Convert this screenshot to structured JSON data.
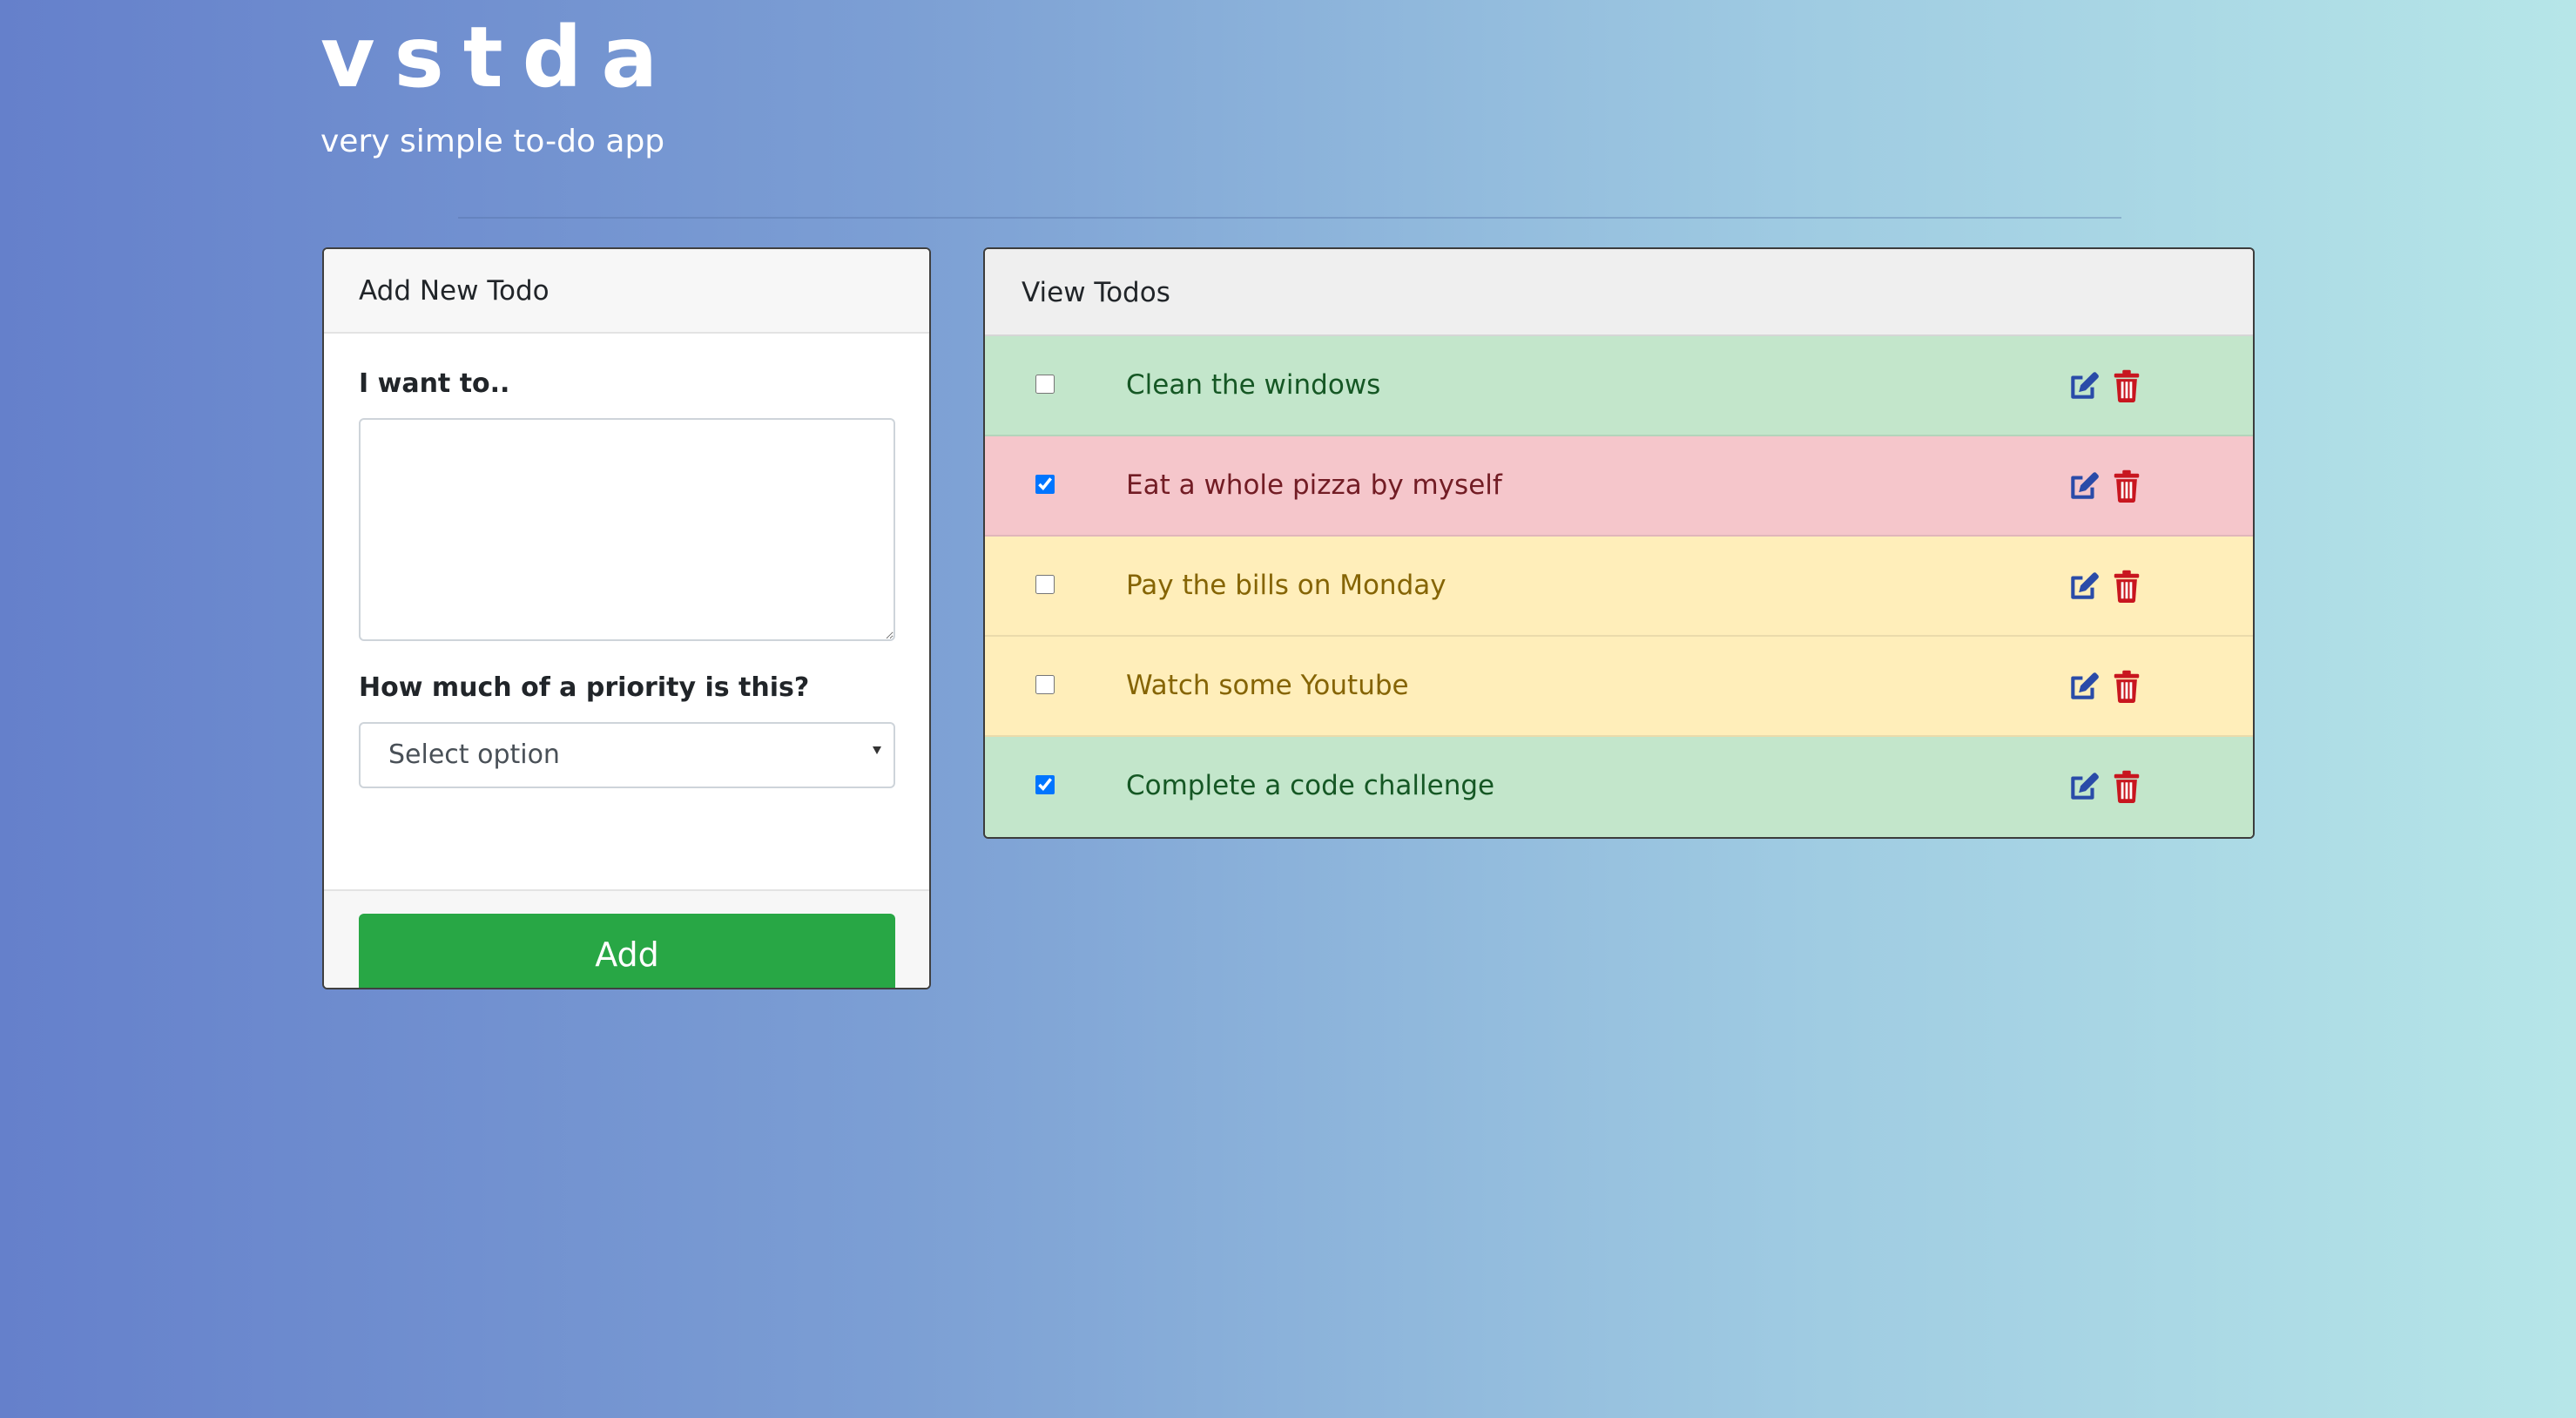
{
  "header": {
    "title": "vstda",
    "subtitle": "very simple to-do app"
  },
  "add_card": {
    "title": "Add New Todo",
    "todo_label": "I want to..",
    "todo_value": "",
    "priority_label": "How much of a priority is this?",
    "priority_selected": "Select option",
    "add_button": "Add"
  },
  "view_card": {
    "title": "View Todos",
    "todos": [
      {
        "text": "Clean the windows",
        "checked": false,
        "priority": "low",
        "bg": "#c3e6cb",
        "fg": "#155724"
      },
      {
        "text": "Eat a whole pizza by myself",
        "checked": true,
        "priority": "high",
        "bg": "#f5c6cb",
        "fg": "#721c24"
      },
      {
        "text": "Pay the bills on Monday",
        "checked": false,
        "priority": "medium",
        "bg": "#ffeeba",
        "fg": "#856404"
      },
      {
        "text": "Watch some Youtube",
        "checked": false,
        "priority": "medium",
        "bg": "#ffeeba",
        "fg": "#856404"
      },
      {
        "text": "Complete a code challenge",
        "checked": true,
        "priority": "low",
        "bg": "#c3e6cb",
        "fg": "#155724"
      }
    ],
    "edit_icon": "edit-icon",
    "delete_icon": "trash-icon"
  },
  "colors": {
    "edit_icon": "#2a4ba8",
    "delete_icon": "#c8161f",
    "add_button": "#28a745",
    "background_start": "#6580cb",
    "background_end": "#b6e6e8"
  }
}
